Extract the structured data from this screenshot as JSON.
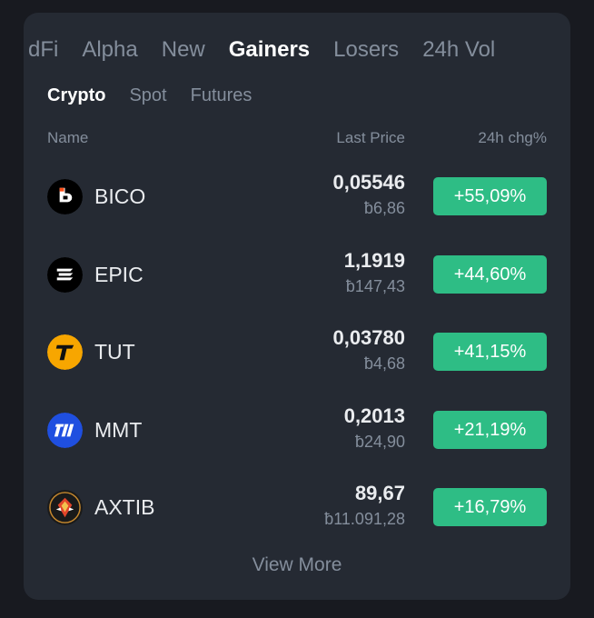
{
  "colors": {
    "background": "#181a20",
    "card": "#252a33",
    "text_primary": "#eaecef",
    "text_secondary": "#848e9c",
    "gain": "#2ebd85"
  },
  "tabs": [
    {
      "label": "dFi",
      "active": false
    },
    {
      "label": "Alpha",
      "active": false
    },
    {
      "label": "New",
      "active": false
    },
    {
      "label": "Gainers",
      "active": true
    },
    {
      "label": "Losers",
      "active": false
    },
    {
      "label": "24h Vol",
      "active": false
    }
  ],
  "subtabs": [
    {
      "label": "Crypto",
      "active": true
    },
    {
      "label": "Spot",
      "active": false
    },
    {
      "label": "Futures",
      "active": false
    }
  ],
  "columns": {
    "name": "Name",
    "price": "Last Price",
    "change": "24h chg%"
  },
  "rows": [
    {
      "symbol": "BICO",
      "icon": "bico-icon",
      "price": "0,05546",
      "fiat": "ƀ6,86",
      "change": "+55,09%"
    },
    {
      "symbol": "EPIC",
      "icon": "epic-icon",
      "price": "1,1919",
      "fiat": "ƀ147,43",
      "change": "+44,60%"
    },
    {
      "symbol": "TUT",
      "icon": "tut-icon",
      "price": "0,03780",
      "fiat": "ƀ4,68",
      "change": "+41,15%"
    },
    {
      "symbol": "MMT",
      "icon": "mmt-icon",
      "price": "0,2013",
      "fiat": "ƀ24,90",
      "change": "+21,19%"
    },
    {
      "symbol": "AXTIB",
      "icon": "axtib-icon",
      "price": "89,67",
      "fiat": "ƀ11.091,28",
      "change": "+16,79%"
    }
  ],
  "view_more": "View More"
}
